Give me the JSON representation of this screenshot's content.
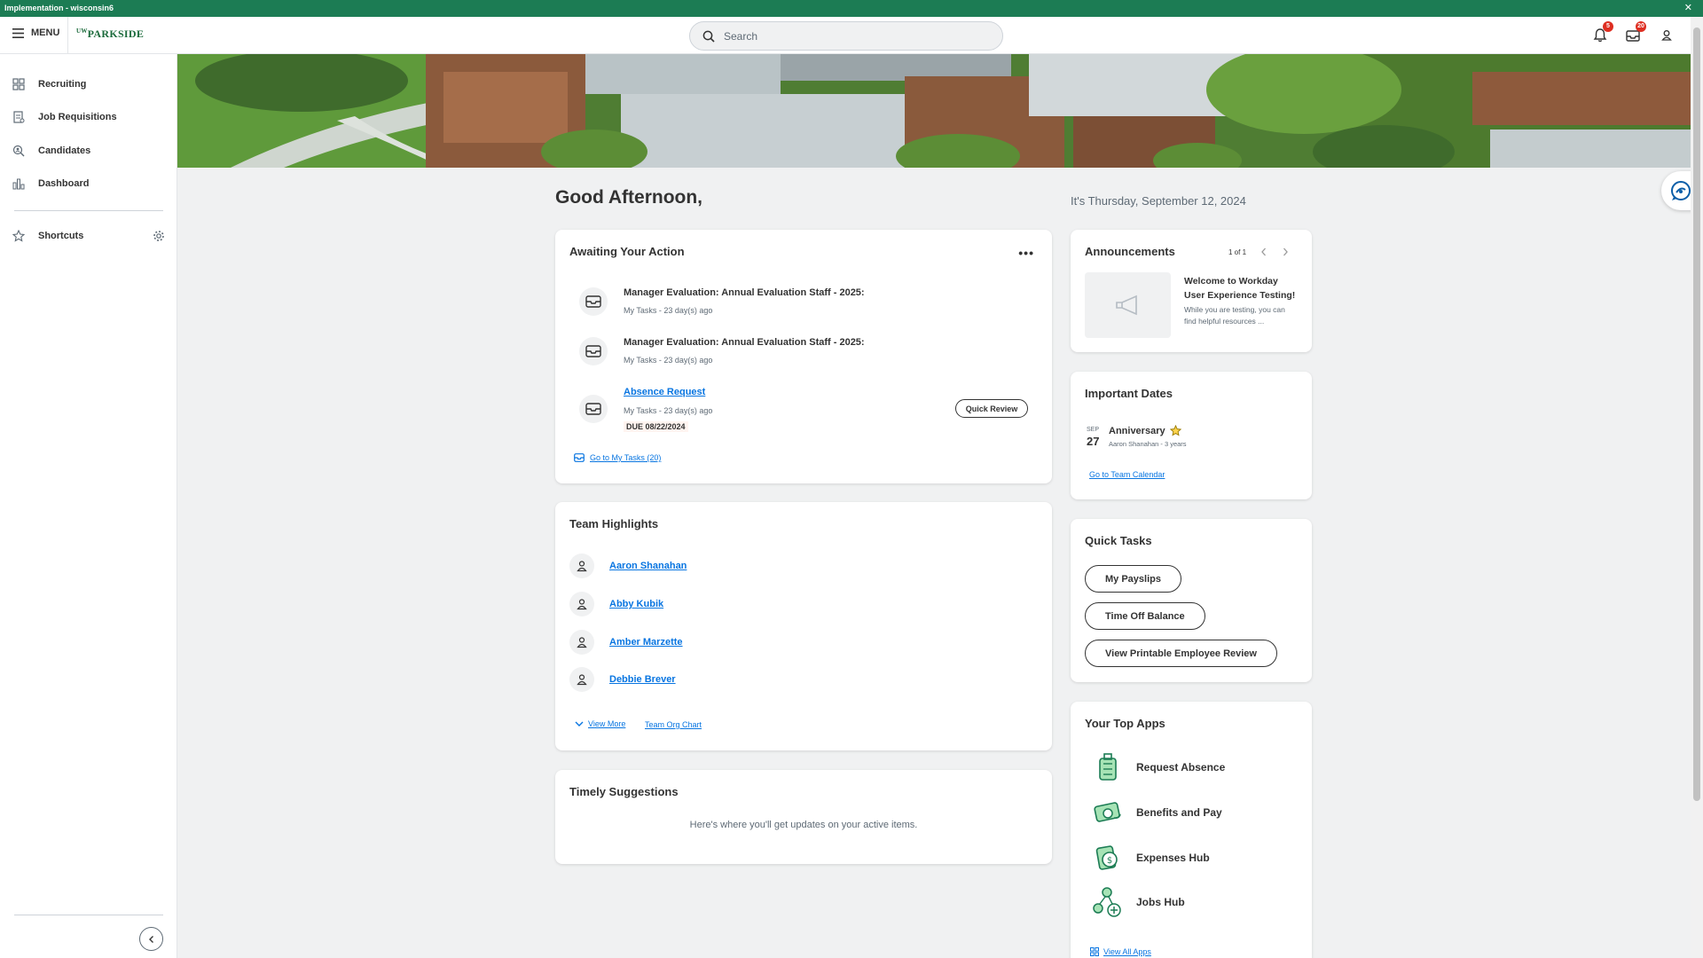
{
  "env": {
    "title": "Implementation - wisconsin6",
    "close": "✕"
  },
  "topbar": {
    "menu_label": "MENU",
    "logo_prefix": "UW",
    "logo_text": "PARKSIDE",
    "search_placeholder": "Search",
    "notifications_count": "5",
    "inbox_count": "20"
  },
  "sidebar": {
    "items": [
      {
        "label": "Recruiting",
        "icon": "grid-icon"
      },
      {
        "label": "Job Requisitions",
        "icon": "requisition-icon"
      },
      {
        "label": "Candidates",
        "icon": "candidate-search-icon"
      },
      {
        "label": "Dashboard",
        "icon": "bar-chart-icon"
      }
    ],
    "shortcuts_label": "Shortcuts"
  },
  "main": {
    "greeting": "Good Afternoon,",
    "date": "It's Thursday, September 12, 2024"
  },
  "awaiting": {
    "title": "Awaiting Your Action",
    "tasks": [
      {
        "title": "Manager Evaluation: Annual Evaluation Staff - 2025:",
        "sub": "My Tasks - 23 day(s) ago"
      },
      {
        "title": "Manager Evaluation: Annual Evaluation Staff - 2025:",
        "sub": "My Tasks - 23 day(s) ago"
      },
      {
        "title": "Absence Request",
        "sub": "My Tasks - 23 day(s) ago",
        "due": "DUE 08/22/2024",
        "action": "Quick Review"
      }
    ],
    "go_to_tasks": "Go to My Tasks (20)"
  },
  "team": {
    "title": "Team Highlights",
    "people": [
      "Aaron Shanahan",
      "Abby Kubik",
      "Amber Marzette",
      "Debbie Brever"
    ],
    "view_more": "View More",
    "org_chart": "Team Org Chart"
  },
  "timely": {
    "title": "Timely Suggestions",
    "message": "Here's where you'll get updates on your active items."
  },
  "announcements": {
    "title": "Announcements",
    "pager": "1 of 1",
    "headline": "Welcome to Workday User Experience Testing!",
    "body": "While you are testing, you can find helpful resources ..."
  },
  "dates": {
    "title": "Important Dates",
    "month": "SEP",
    "day": "27",
    "event": "Anniversary",
    "detail": "Aaron Shanahan - 3 years",
    "link": "Go to Team Calendar"
  },
  "quick_tasks": {
    "title": "Quick Tasks",
    "items": [
      "My Payslips",
      "Time Off Balance",
      "View Printable Employee Review"
    ]
  },
  "top_apps": {
    "title": "Your Top Apps",
    "items": [
      "Request Absence",
      "Benefits and Pay",
      "Expenses Hub",
      "Jobs Hub"
    ],
    "view_all": "View All Apps"
  },
  "colors": {
    "brand_green": "#1c7c54",
    "link_blue": "#0875e1",
    "badge_red": "#de2e21"
  }
}
